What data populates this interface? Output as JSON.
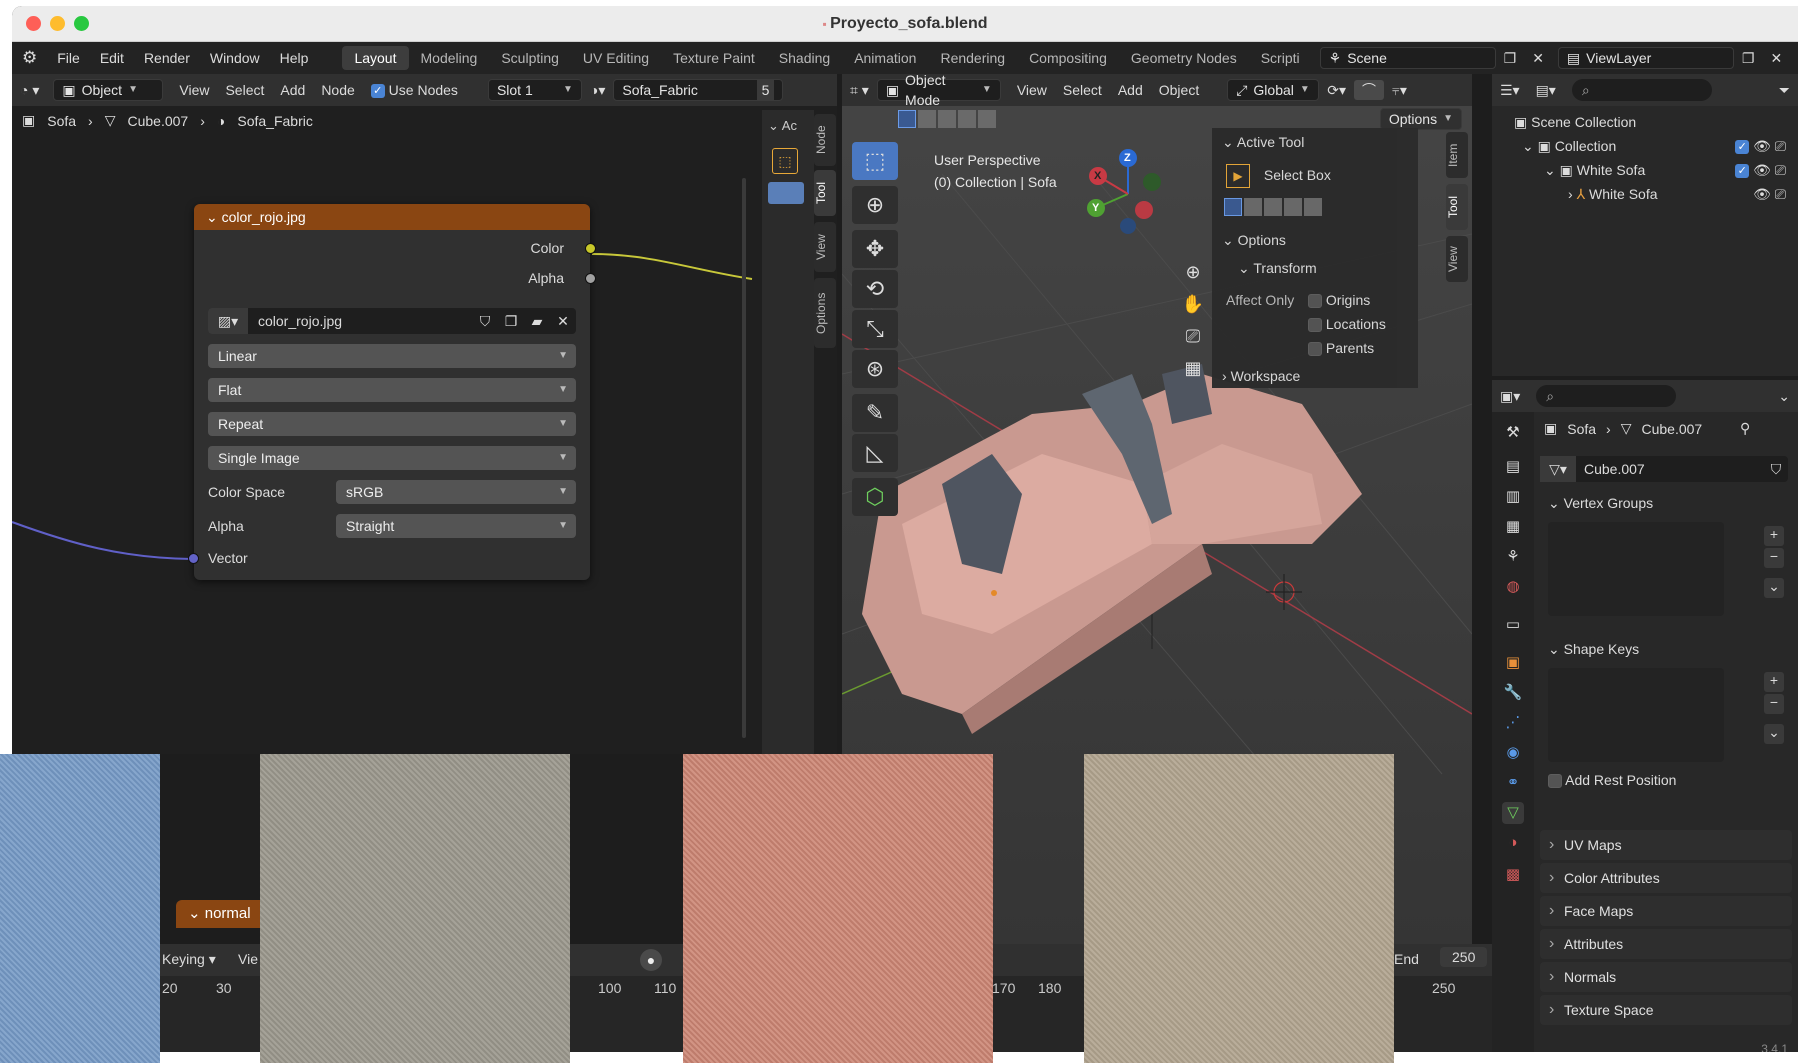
{
  "window": {
    "title": "Proyecto_sofa.blend"
  },
  "menu": [
    "File",
    "Edit",
    "Render",
    "Window",
    "Help"
  ],
  "workspaces": [
    "Layout",
    "Modeling",
    "Sculpting",
    "UV Editing",
    "Texture Paint",
    "Shading",
    "Animation",
    "Rendering",
    "Compositing",
    "Geometry Nodes",
    "Scripti"
  ],
  "scene": {
    "name": "Scene",
    "view_layer": "ViewLayer"
  },
  "node_editor": {
    "header": {
      "mode": "Object",
      "view": "View",
      "select": "Select",
      "add": "Add",
      "node": "Node",
      "use_nodes": "Use Nodes",
      "slot": "Slot 1",
      "material": "Sofa_Fabric",
      "users": "5"
    },
    "breadcrumb": [
      "Sofa",
      "Cube.007",
      "Sofa_Fabric"
    ],
    "side_tabs": [
      "Node",
      "Tool",
      "View",
      "Options"
    ],
    "side_partial": "Ac",
    "node": {
      "title": "color_rojo.jpg",
      "out_color": "Color",
      "out_alpha": "Alpha",
      "image_name": "color_rojo.jpg",
      "interpolation": "Linear",
      "projection": "Flat",
      "extension": "Repeat",
      "source": "Single Image",
      "color_space_label": "Color Space",
      "color_space": "sRGB",
      "alpha_label": "Alpha",
      "alpha": "Straight",
      "in_vector": "Vector"
    },
    "node2_title": "normal"
  },
  "viewport": {
    "header": {
      "mode": "Object Mode",
      "view": "View",
      "select": "Select",
      "add": "Add",
      "object": "Object",
      "transform": "Global",
      "options": "Options"
    },
    "overlay_line1": "User Perspective",
    "overlay_line2": "(0) Collection | Sofa",
    "gizmo": {
      "x": "X",
      "y": "Y",
      "z": "Z"
    },
    "active_tool": {
      "title": "Active Tool",
      "tool": "Select Box"
    },
    "options": {
      "title": "Options",
      "transform": "Transform",
      "affect_only": "Affect Only",
      "origins": "Origins",
      "locations": "Locations",
      "parents": "Parents",
      "workspace": "Workspace"
    },
    "side_tabs": [
      "Item",
      "Tool",
      "View"
    ]
  },
  "timeline": {
    "keying": "Keying",
    "view": "Vie",
    "end_label": "End",
    "end": "250",
    "ticks": [
      "20",
      "30",
      "100",
      "110",
      "170",
      "180",
      "250"
    ]
  },
  "outliner": {
    "root": "Scene Collection",
    "items": [
      {
        "label": "Collection"
      },
      {
        "label": "White Sofa"
      },
      {
        "label": "White Sofa"
      }
    ]
  },
  "properties": {
    "breadcrumb": [
      "Sofa",
      "Cube.007"
    ],
    "mesh_name": "Cube.007",
    "sections": {
      "vertex_groups": "Vertex Groups",
      "shape_keys": "Shape Keys",
      "add_rest": "Add Rest Position"
    },
    "collapsed": [
      "UV Maps",
      "Color Attributes",
      "Face Maps",
      "Attributes",
      "Normals",
      "Texture Space"
    ]
  },
  "status": {
    "version": "3.4.1"
  },
  "colors": {
    "accent": "#4a84d4",
    "node_header": "#8a4612",
    "swatch_blue": "#7a9cc4",
    "swatch_grey": "#9d9a90",
    "swatch_pink": "#c98878",
    "swatch_beige": "#b1a592",
    "sofa": "#c99990"
  }
}
